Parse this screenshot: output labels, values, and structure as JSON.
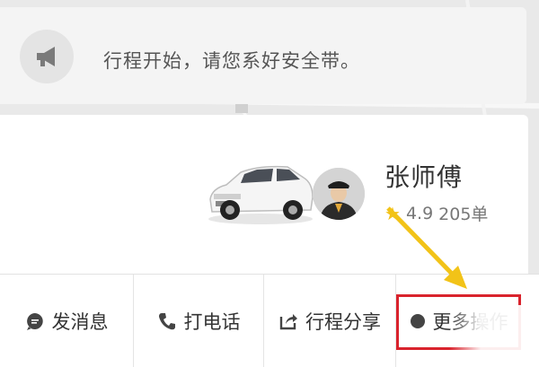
{
  "notice": {
    "icon": "megaphone-icon",
    "text": "行程开始，请您系好安全带。"
  },
  "driver": {
    "name": "张师傅",
    "rating": "4.9",
    "orders": "205单",
    "star_color": "#f3c21b",
    "car_image": "white-suv",
    "avatar": "driver-avatar"
  },
  "actions": [
    {
      "icon": "message-bubble-icon",
      "label": "发消息"
    },
    {
      "icon": "phone-icon",
      "label": "打电话"
    },
    {
      "icon": "share-icon",
      "label": "行程分享"
    },
    {
      "icon": "more-icon",
      "label": "更多操作"
    }
  ],
  "colors": {
    "highlight": "#d9232d",
    "arrow": "#f2c318"
  }
}
